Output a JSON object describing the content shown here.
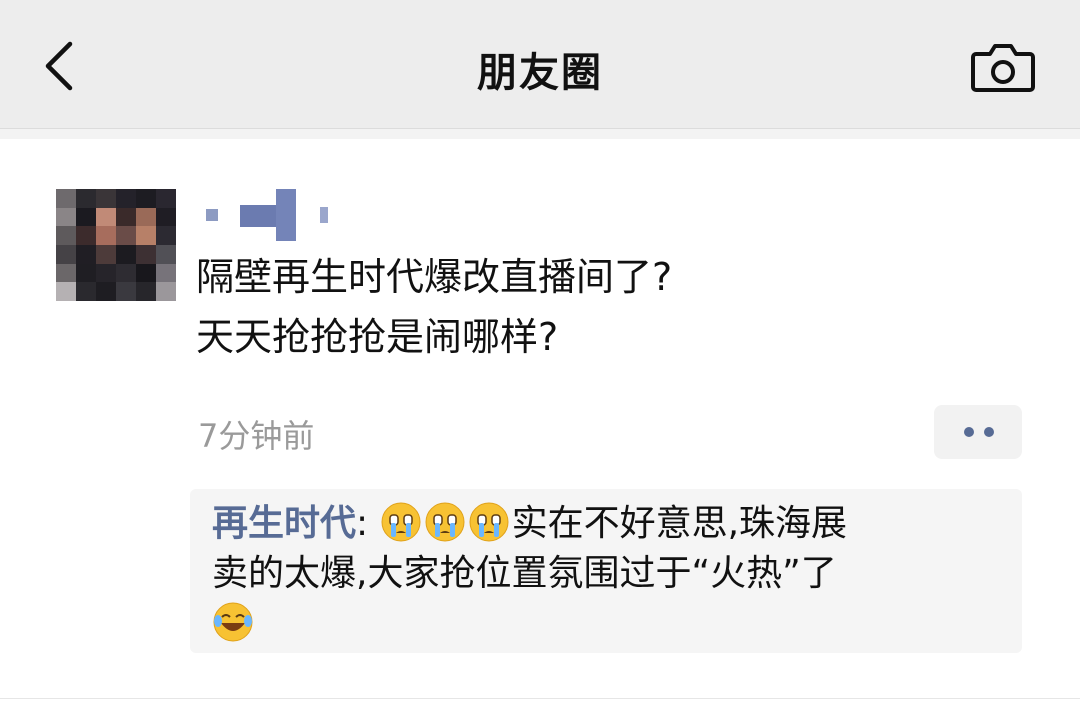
{
  "header": {
    "title": "朋友圈",
    "back_icon": "chevron-left-icon",
    "camera_icon": "camera-icon"
  },
  "post": {
    "content_lines": [
      "隔壁再生时代爆改直播间了?",
      "天天抢抢抢是闹哪样?"
    ],
    "time": "7分钟前",
    "more_icon": "two-dots-icon"
  },
  "comment": {
    "author": "再生时代",
    "separator": ":",
    "emoji_before": [
      "crying-face-emoji",
      "crying-face-emoji",
      "crying-face-emoji"
    ],
    "text_line1": "实在不好意思,珠海展",
    "text_line2": "卖的太爆,大家抢位置氛围过于“火热”了",
    "emoji_after": "laughing-tears-emoji"
  },
  "colors": {
    "header_bg": "#ededed",
    "link_blue": "#576b95",
    "time_gray": "#9a9a9a",
    "comment_bg": "#f5f5f5"
  }
}
